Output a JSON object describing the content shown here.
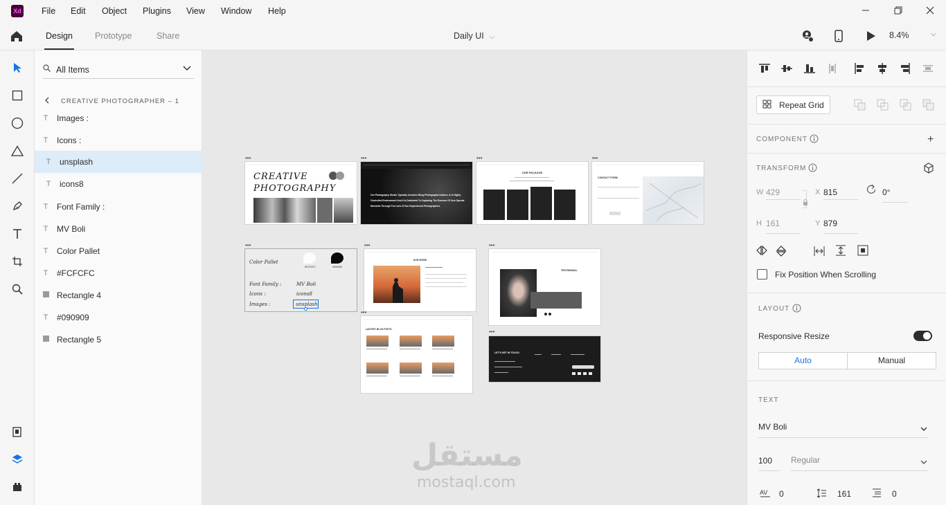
{
  "app": {
    "logo": "Xd",
    "menu": [
      "File",
      "Edit",
      "Object",
      "Plugins",
      "View",
      "Window",
      "Help"
    ],
    "window_controls": [
      "minimize-icon",
      "restore-icon",
      "close-icon"
    ]
  },
  "modebar": {
    "tabs": [
      "Design",
      "Prototype",
      "Share"
    ],
    "active_tab": "Design",
    "document_title": "Daily UI",
    "zoom": "8.4%"
  },
  "layers": {
    "filter_label": "All Items",
    "breadcrumb": "CREATIVE PHOTOGRAPHER – 1",
    "items": [
      {
        "label": "Images :",
        "type": "text"
      },
      {
        "label": "Icons :",
        "type": "text"
      },
      {
        "label": "unsplash",
        "type": "text",
        "selected": true
      },
      {
        "label": "icons8",
        "type": "text"
      },
      {
        "label": "Font Family :",
        "type": "text"
      },
      {
        "label": "MV Boli",
        "type": "text"
      },
      {
        "label": "Color Pallet",
        "type": "text"
      },
      {
        "label": "#FCFCFC",
        "type": "text"
      },
      {
        "label": "Rectangle 4",
        "type": "rect"
      },
      {
        "label": "#090909",
        "type": "text"
      },
      {
        "label": "Rectangle 5",
        "type": "rect"
      }
    ]
  },
  "canvas": {
    "hero_title_1": "CREATIVE",
    "hero_title_2": "PHOTOGRAPHY",
    "style_card": {
      "color_pallet": "Color Pallet",
      "swatch_light": "#FCFCFC",
      "swatch_dark": "#090909",
      "font_family_label": "Font Family :",
      "font_family_value": "MV Boli",
      "icons_label": "Icons :",
      "icons_value": "icons8",
      "images_label": "Images :",
      "images_value": "unsplash"
    },
    "dark_hero_text": "Our Photography Studio Typically Involves Siting Photographs Indoors, In A Highly Controlled Environment And It Is Dedicated To Capturing The Essence Of Your Special Moments Through The Lens Of Our Experienced Photographers",
    "package_title": "OUR PACKAGE",
    "contact_title": "CONTACT FORM",
    "work_title": "OUR WORK",
    "testimonial_title": "TESTIMONIAL",
    "blog_title": "LASTEST BLOG POSTS",
    "footer_title": "LET'S GET IN TOUCH",
    "watermark_ar": "مستقل",
    "watermark_en": "mostaql.com"
  },
  "props": {
    "repeat_grid": "Repeat Grid",
    "component_label": "COMPONENT",
    "transform_label": "TRANSFORM",
    "w_label": "W",
    "w_value": "429",
    "x_label": "X",
    "x_value": "815",
    "h_label": "H",
    "h_value": "161",
    "y_label": "Y",
    "y_value": "879",
    "rotation": "0°",
    "fix_position": "Fix Position When Scrolling",
    "layout_label": "LAYOUT",
    "responsive_resize": "Responsive Resize",
    "auto": "Auto",
    "manual": "Manual",
    "text_label": "TEXT",
    "font": "MV Boli",
    "font_size": "100",
    "font_weight": "Regular",
    "char_spacing": "0",
    "line_spacing": "161",
    "para_spacing": "0"
  },
  "colors": {
    "accent": "#1473e6",
    "selection": "#dcecf9",
    "dark": "#1c1c1c"
  }
}
